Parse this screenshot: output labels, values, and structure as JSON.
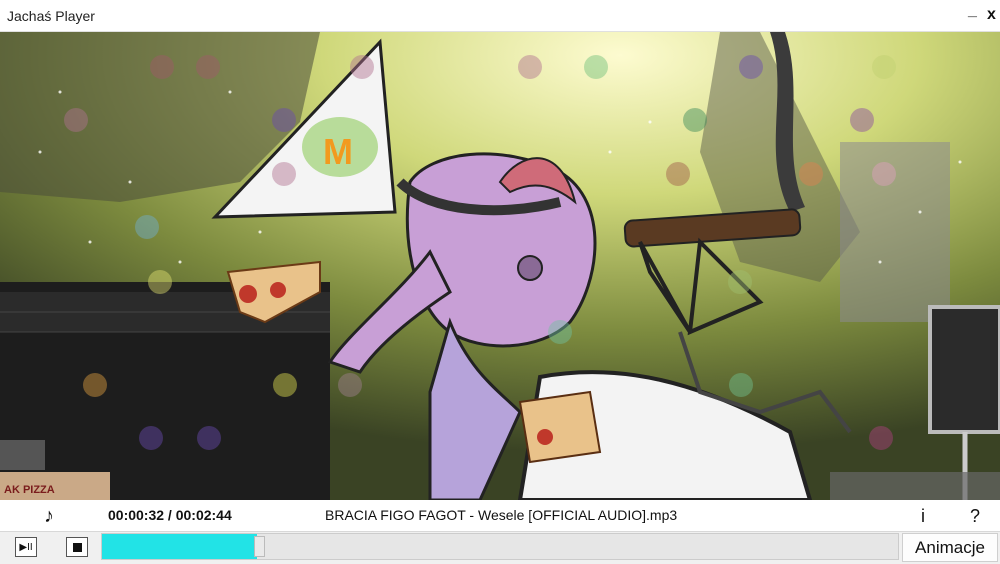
{
  "window": {
    "title": "Jachaś Player",
    "minimize_label": "_",
    "close_label": "x"
  },
  "player": {
    "note_icon": "♪",
    "time": "00:00:32 / 00:02:44",
    "track": "BRACIA FIGO FAGOT - Wesele [OFFICIAL AUDIO].mp3",
    "info_label": "i",
    "help_label": "?",
    "playpause_label": "▶II",
    "progress_fraction": 0.195,
    "progress_color": "#22e3e6",
    "animations_label": "Animacje"
  },
  "artwork": {
    "pizza_sign_text": "AK PIZZA",
    "m_logo_text": "M"
  }
}
